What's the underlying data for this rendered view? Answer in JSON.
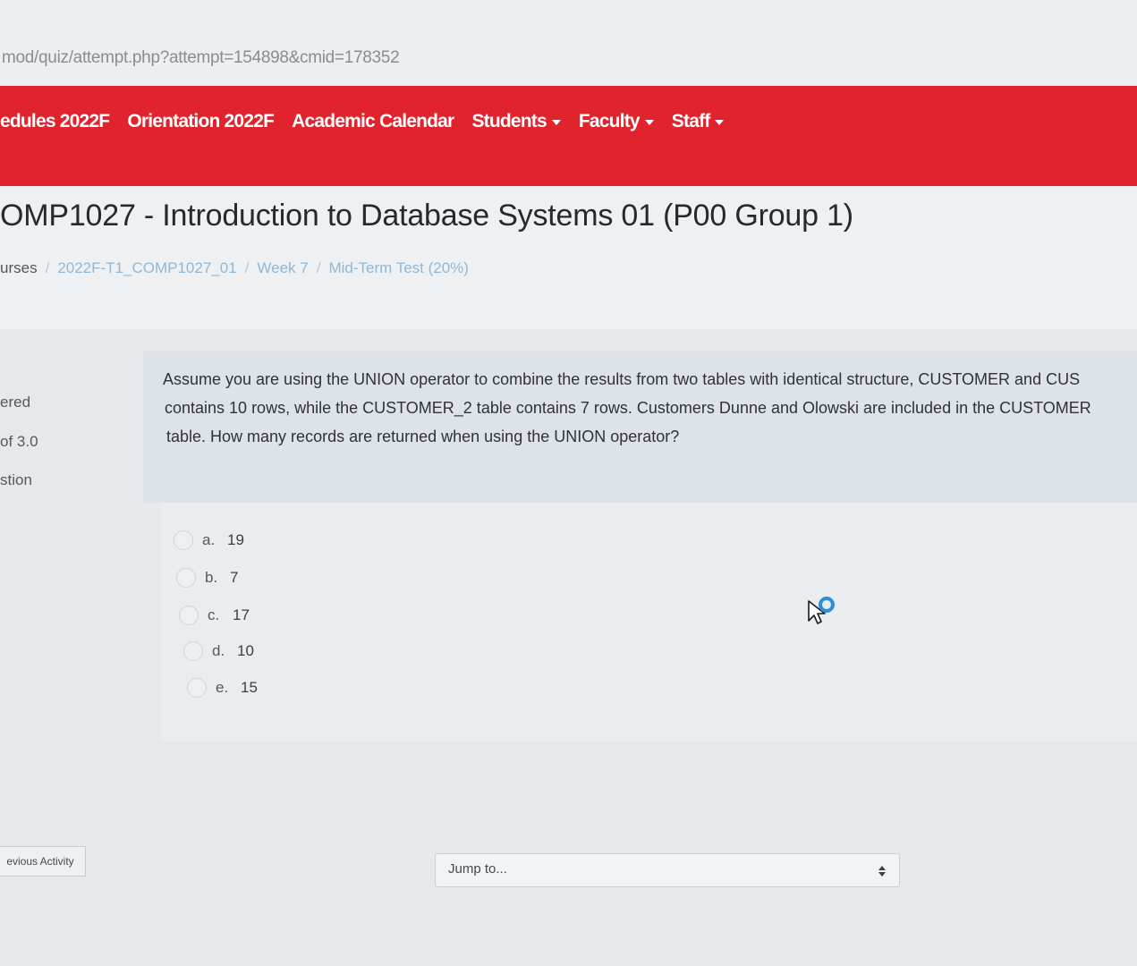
{
  "browser": {
    "url": "mod/quiz/attempt.php?attempt=154898&cmid=178352"
  },
  "navbar": {
    "items": [
      {
        "label": "edules 2022F"
      },
      {
        "label": "Orientation 2022F"
      },
      {
        "label": "Academic Calendar"
      },
      {
        "label": "Students"
      },
      {
        "label": "Faculty"
      },
      {
        "label": "Staff"
      }
    ]
  },
  "header": {
    "title": "OMP1027 - Introduction to Database Systems 01 (P00 Group 1)",
    "breadcrumb": [
      "urses",
      "2022F-T1_COMP1027_01",
      "Week 7",
      "Mid-Term Test (20%)"
    ]
  },
  "question_info": {
    "state": "ered",
    "marks": "of 3.0",
    "flag": "stion"
  },
  "question": {
    "lines": [
      "Assume you are using the UNION operator to combine the results from two tables with identical structure, CUSTOMER and CUS",
      "contains 10 rows, while the CUSTOMER_2 table contains 7 rows. Customers Dunne and Olowski are included in the CUSTOMER",
      "table. How many records are returned when using the UNION operator?"
    ],
    "answers": [
      {
        "letter": "a.",
        "value": "19"
      },
      {
        "letter": "b.",
        "value": "7"
      },
      {
        "letter": "c.",
        "value": "17"
      },
      {
        "letter": "d.",
        "value": "10"
      },
      {
        "letter": "e.",
        "value": "15"
      }
    ]
  },
  "footer": {
    "prev_label": "evious Activity",
    "jump_placeholder": "Jump to..."
  },
  "colors": {
    "navbar": "#e1232e",
    "link": "#8fb8d8",
    "cursor_ring": "#2d8fd6"
  }
}
